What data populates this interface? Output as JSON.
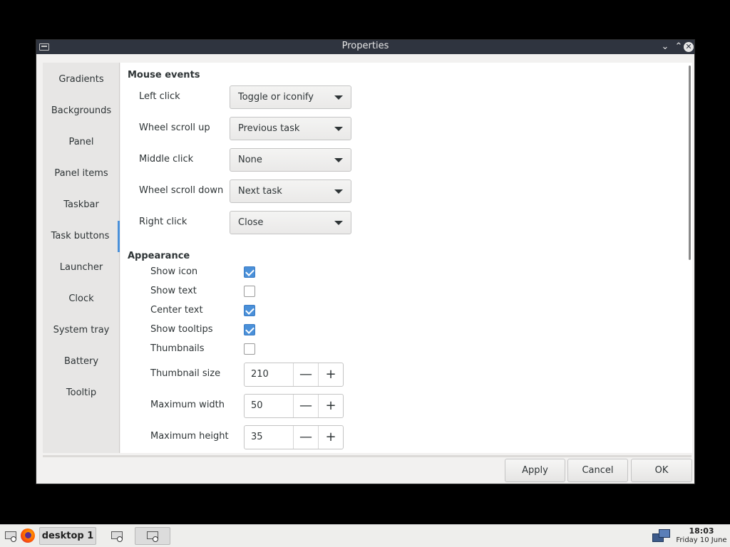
{
  "window": {
    "title": "Properties",
    "buttons": [
      "minimize",
      "maximize",
      "close"
    ]
  },
  "sidebar": {
    "items": [
      {
        "label": "Gradients"
      },
      {
        "label": "Backgrounds"
      },
      {
        "label": "Panel"
      },
      {
        "label": "Panel items"
      },
      {
        "label": "Taskbar"
      },
      {
        "label": "Task buttons"
      },
      {
        "label": "Launcher"
      },
      {
        "label": "Clock"
      },
      {
        "label": "System tray"
      },
      {
        "label": "Battery"
      },
      {
        "label": "Tooltip"
      }
    ],
    "active": "Task buttons"
  },
  "mouse_events": {
    "title": "Mouse events",
    "rows": [
      {
        "label": "Left click",
        "value": "Toggle or iconify"
      },
      {
        "label": "Wheel scroll up",
        "value": "Previous task"
      },
      {
        "label": "Middle click",
        "value": "None"
      },
      {
        "label": "Wheel scroll down",
        "value": "Next task"
      },
      {
        "label": "Right click",
        "value": "Close"
      }
    ]
  },
  "appearance": {
    "title": "Appearance",
    "checkboxes": [
      {
        "label": "Show icon",
        "checked": true
      },
      {
        "label": "Show text",
        "checked": false
      },
      {
        "label": "Center text",
        "checked": true
      },
      {
        "label": "Show tooltips",
        "checked": true
      },
      {
        "label": "Thumbnails",
        "checked": false
      }
    ],
    "spinners": [
      {
        "label": "Thumbnail size",
        "value": "210"
      },
      {
        "label": "Maximum width",
        "value": "50"
      },
      {
        "label": "Maximum height",
        "value": "35"
      }
    ],
    "minus_glyph": "—",
    "plus_glyph": "+"
  },
  "footer": {
    "apply": "Apply",
    "cancel": "Cancel",
    "ok": "OK"
  },
  "taskbar": {
    "desktop_label": "desktop 1",
    "time": "18:03",
    "date": "Friday 10 June"
  },
  "colors": {
    "accent": "#4a90d9",
    "titlebar": "#2f343f"
  }
}
